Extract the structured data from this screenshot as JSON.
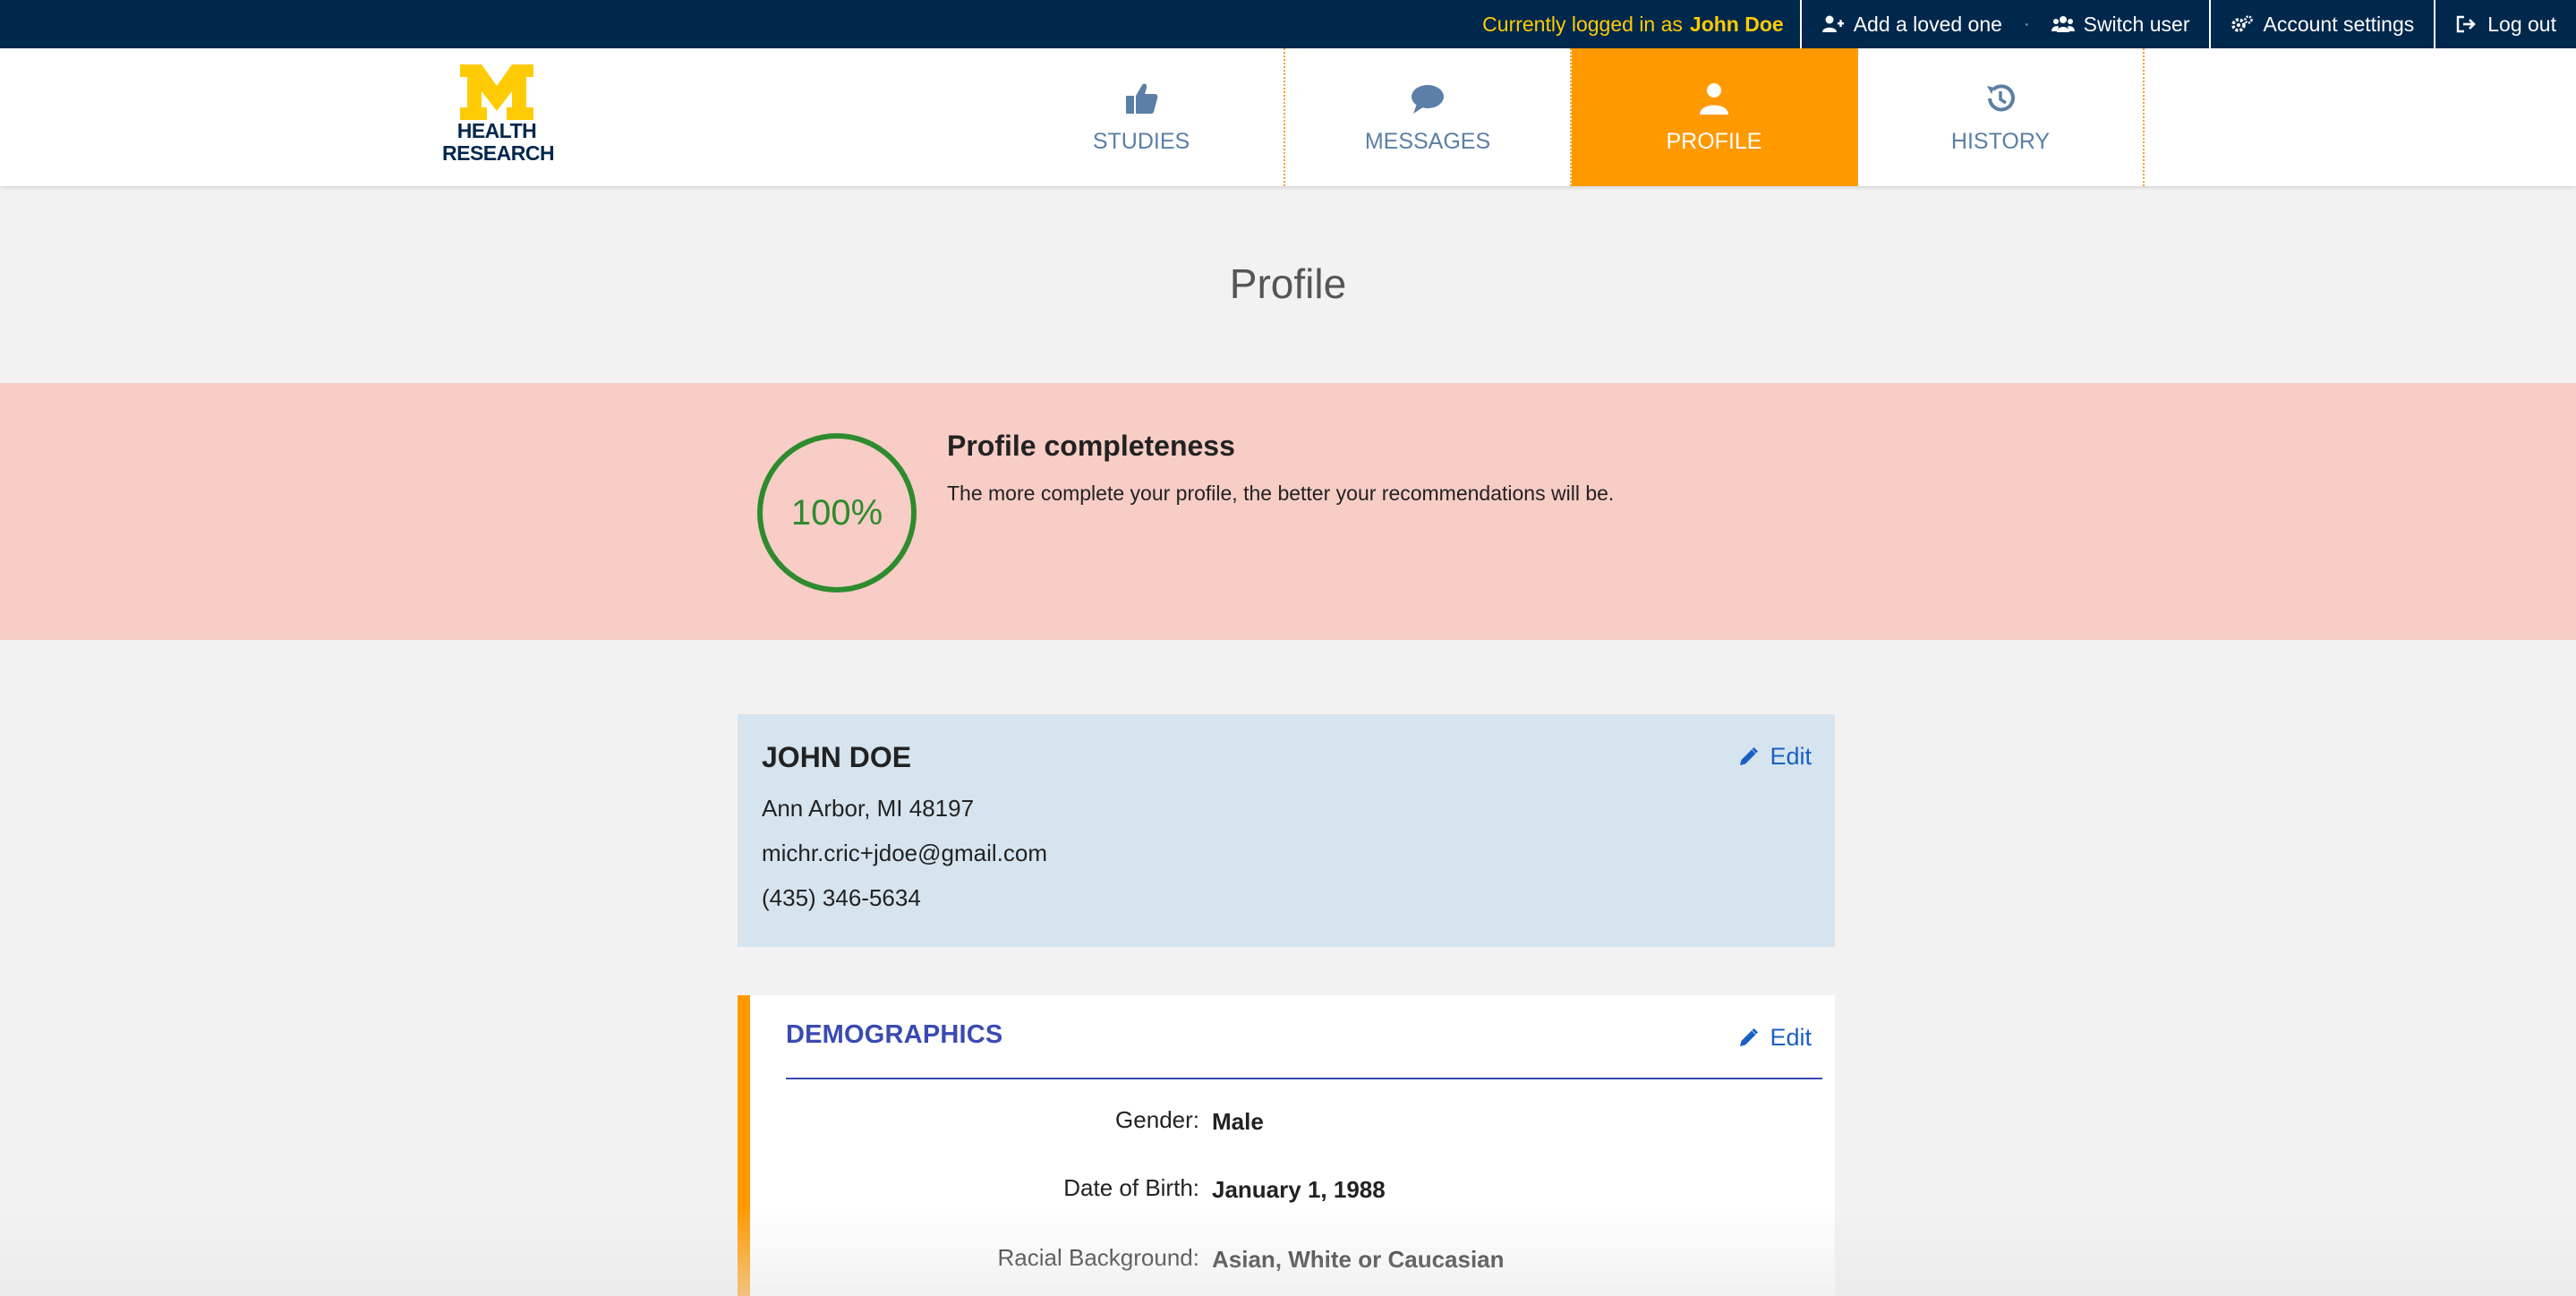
{
  "topbar": {
    "login_prefix": "Currently logged in as",
    "login_user": "John Doe",
    "items": [
      {
        "label": "Add a loved one",
        "icon": "add-user-icon"
      },
      {
        "label": "Switch user",
        "icon": "users-icon"
      },
      {
        "label": "Account settings",
        "icon": "gears-icon"
      },
      {
        "label": "Log out",
        "icon": "sign-out-icon"
      }
    ]
  },
  "logo": {
    "line1": "HEALTH",
    "line2": "RESEARCH",
    "mark": "M"
  },
  "nav": {
    "tabs": [
      {
        "label": "STUDIES",
        "icon": "thumbs-up-icon",
        "active": false
      },
      {
        "label": "MESSAGES",
        "icon": "speech-bubble-icon",
        "active": false
      },
      {
        "label": "PROFILE",
        "icon": "user-icon",
        "active": true
      },
      {
        "label": "HISTORY",
        "icon": "history-icon",
        "active": false
      }
    ]
  },
  "page": {
    "title": "Profile"
  },
  "completeness": {
    "percent_label": "100%",
    "percent_value": 100,
    "heading": "Profile completeness",
    "description": "The more complete your profile, the better your recommendations will be.",
    "ring_color": "#2e8b2e"
  },
  "identity": {
    "name": "JOHN DOE",
    "location": "Ann Arbor, MI 48197",
    "email": "michr.cric+jdoe@gmail.com",
    "phone": "(435) 346-5634",
    "edit_label": "Edit"
  },
  "demographics": {
    "title": "DEMOGRAPHICS",
    "edit_label": "Edit",
    "rows": [
      {
        "label": "Gender:",
        "value": "Male"
      },
      {
        "label": "Date of Birth:",
        "value": "January 1, 1988"
      },
      {
        "label": "Racial Background:",
        "value": "Asian, White or Caucasian"
      }
    ]
  },
  "colors": {
    "topbar": "#00274c",
    "accent": "#ff9900",
    "maize": "#ffcb05",
    "banner": "#f7cdc6",
    "identity_card": "#d6e4ef",
    "link": "#1a5fc4",
    "section_title": "#3a4ab2"
  }
}
